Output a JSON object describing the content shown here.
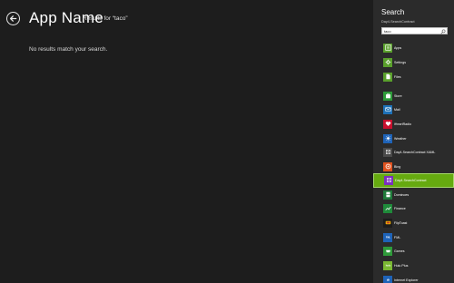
{
  "main": {
    "title": "App Name",
    "results_for": "Results for “taco”",
    "no_results": "No results match your search."
  },
  "pane": {
    "title": "Search",
    "subtitle": "Day4-SearchContract",
    "query": "taco"
  },
  "apps": [
    {
      "label": "Apps",
      "icon": "apps-icon",
      "color": "#5aa02c"
    },
    {
      "label": "Settings",
      "icon": "settings-icon",
      "color": "#5aa02c"
    },
    {
      "label": "Files",
      "icon": "files-icon",
      "color": "#5aa02c"
    },
    {
      "label": "Store",
      "icon": "store-icon",
      "color": "#2e9b3a"
    },
    {
      "label": "Mail",
      "icon": "mail-icon",
      "color": "#1d71b8"
    },
    {
      "label": "iHeartRadio",
      "icon": "iheartradio-icon",
      "color": "#c8102e"
    },
    {
      "label": "Weather",
      "icon": "weather-icon",
      "color": "#1e63b8"
    },
    {
      "label": "Day4-SearchContract XAML",
      "icon": "app-placeholder-icon",
      "color": "#4a4a4a"
    },
    {
      "label": "Bing",
      "icon": "bing-icon",
      "color": "#e0521f"
    },
    {
      "label": "Day4-SearchContract",
      "icon": "app-placeholder-icon",
      "color": "#7b2fbf",
      "selected": true
    },
    {
      "label": "Dominoes",
      "icon": "dominoes-icon",
      "color": "#1f7a3a"
    },
    {
      "label": "Finance",
      "icon": "finance-icon",
      "color": "#1f8a3a"
    },
    {
      "label": "FlipToast",
      "icon": "fliptoast-icon",
      "color": "#1d1d1d"
    },
    {
      "label": "FML",
      "icon": "fml-icon",
      "color": "#1e63b8"
    },
    {
      "label": "Games",
      "icon": "games-icon",
      "color": "#2e9b3a"
    },
    {
      "label": "Hulu Plus",
      "icon": "hulu-icon",
      "color": "#7ab833"
    },
    {
      "label": "Internet Explorer",
      "icon": "internet-explorer-icon",
      "color": "#1e63b8"
    }
  ]
}
